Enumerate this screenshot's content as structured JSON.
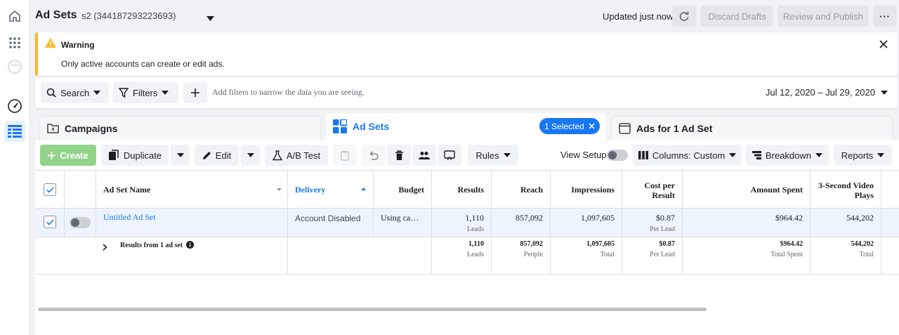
{
  "header": {
    "title": "Ad Sets",
    "account": "s2 (344187293223693)",
    "updated": "Updated just now",
    "discard_label": "Discard Drafts",
    "review_label": "Review and Publish"
  },
  "warning": {
    "title": "Warning",
    "message": "Only active accounts can create or edit ads."
  },
  "filterbar": {
    "search_label": "Search",
    "filters_label": "Filters",
    "hint": "Add filters to narrow the data you are seeing.",
    "date_range": "Jul 12, 2020 – Jul 29, 2020"
  },
  "tabs": {
    "campaigns": "Campaigns",
    "adsets": "Ad Sets",
    "selected": "1 Selected",
    "ads": "Ads for 1 Ad Set"
  },
  "toolbar": {
    "create": "Create",
    "duplicate": "Duplicate",
    "edit": "Edit",
    "ab_test": "A/B Test",
    "rules": "Rules",
    "view_setup": "View Setup",
    "columns": "Columns: Custom",
    "breakdown": "Breakdown",
    "reports": "Reports"
  },
  "table": {
    "headers": {
      "name": "Ad Set Name",
      "delivery": "Delivery",
      "budget": "Budget",
      "results": "Results",
      "reach": "Reach",
      "impressions": "Impressions",
      "cpr_line1": "Cost per",
      "cpr_line2": "Result",
      "amount": "Amount Spent",
      "video_line1": "3-Second Video",
      "video_line2": "Plays"
    },
    "row": {
      "name": "Untitled Ad Set",
      "delivery": "Account Disabled",
      "budget": "Using ca…",
      "results": "1,110",
      "results_sub": "Leads",
      "reach": "857,092",
      "impressions": "1,097,605",
      "cpr": "$0.87",
      "cpr_sub": "Per Lead",
      "amount": "$964.42",
      "video": "544,202"
    },
    "summary": {
      "label": "Results from 1 ad set",
      "results": "1,110",
      "results_sub": "Leads",
      "reach": "857,092",
      "reach_sub": "People",
      "impressions": "1,097,605",
      "impressions_sub": "Total",
      "cpr": "$0.87",
      "cpr_sub": "Per Lead",
      "amount": "$964.42",
      "amount_sub": "Total Spent",
      "video": "544,202",
      "video_sub": "Total"
    }
  },
  "colors": {
    "accent": "#1877f2",
    "warning": "#f7b928",
    "create_button": "#92d38c",
    "selected_row": "#edf4fe"
  }
}
